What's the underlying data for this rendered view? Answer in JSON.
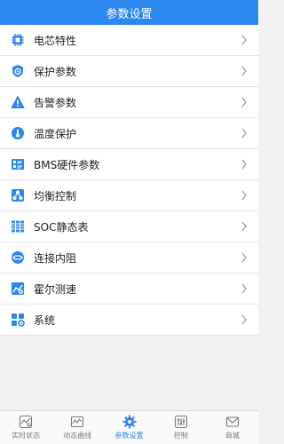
{
  "header": {
    "title": "参数设置"
  },
  "menu": {
    "items": [
      {
        "label": "电芯特性",
        "icon": "battery-cell-icon"
      },
      {
        "label": "保护参数",
        "icon": "shield-gear-icon"
      },
      {
        "label": "告警参数",
        "icon": "warning-icon"
      },
      {
        "label": "温度保护",
        "icon": "thermometer-icon"
      },
      {
        "label": "BMS硬件参数",
        "icon": "hardware-list-icon"
      },
      {
        "label": "均衡控制",
        "icon": "balance-network-icon"
      },
      {
        "label": "SOC静态表",
        "icon": "table-grid-icon"
      },
      {
        "label": "连接内阻",
        "icon": "resistance-icon"
      },
      {
        "label": "霍尔测速",
        "icon": "speed-chart-icon"
      },
      {
        "label": "系统",
        "icon": "system-apps-icon"
      }
    ]
  },
  "tabbar": {
    "tabs": [
      {
        "label": "实时状态",
        "icon": "realtime-status-icon",
        "active": false
      },
      {
        "label": "动态曲线",
        "icon": "dynamic-curve-icon",
        "active": false
      },
      {
        "label": "参数设置",
        "icon": "settings-gear-icon",
        "active": true
      },
      {
        "label": "控制",
        "icon": "control-sliders-icon",
        "active": false
      },
      {
        "label": "商城",
        "icon": "mall-envelope-icon",
        "active": false
      }
    ]
  },
  "colors": {
    "accent": "#2d87f0",
    "tab_inactive": "#7a7a7a",
    "background": "#f2f2f2"
  }
}
